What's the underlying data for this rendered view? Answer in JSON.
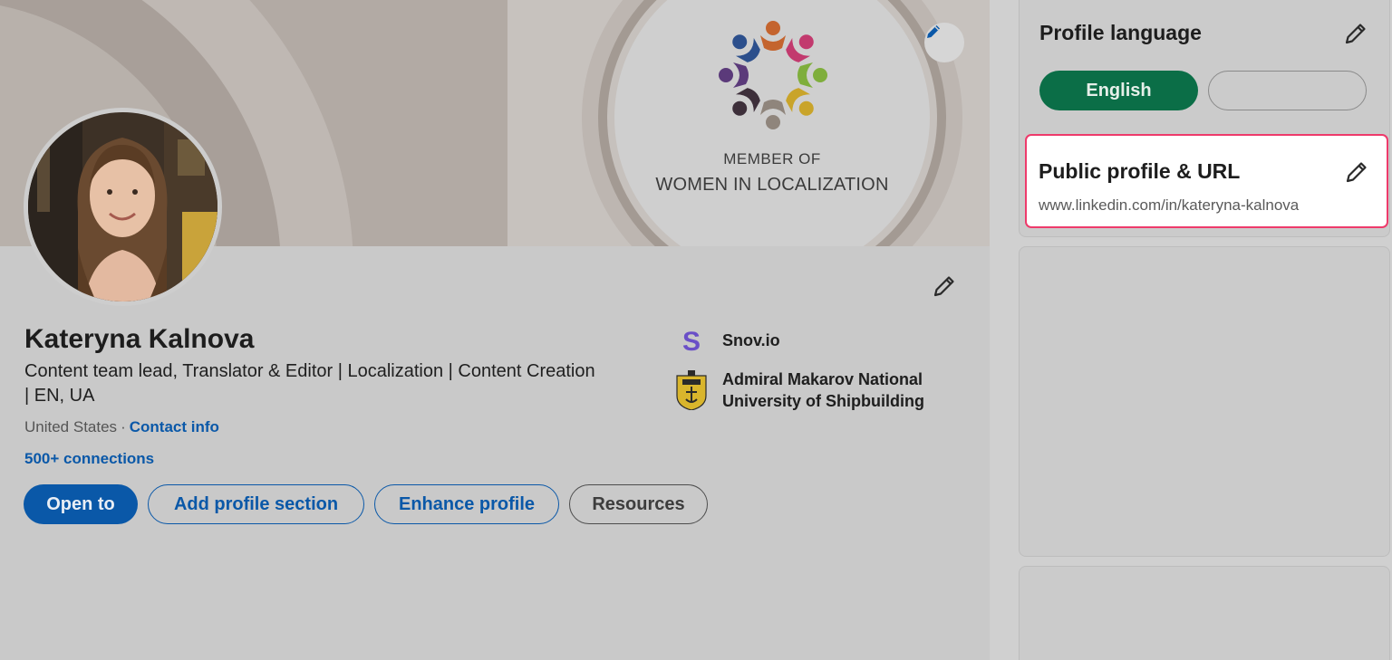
{
  "banner": {
    "line1": "MEMBER OF",
    "line2": "WOMEN IN LOCALIZATION"
  },
  "profile": {
    "name": "Kateryna Kalnova",
    "headline": "Content team lead, Translator & Editor | Localization | Content Creation | EN, UA",
    "location": "United States",
    "separator": "·",
    "contact_label": "Contact info",
    "connections": "500+ connections"
  },
  "actions": {
    "open_to": "Open to",
    "add_section": "Add profile section",
    "enhance": "Enhance profile",
    "resources": "Resources"
  },
  "organizations": [
    {
      "name": "Snov.io",
      "icon": "snovio-logo"
    },
    {
      "name_line1": "Admiral Makarov National",
      "name_line2": "University of Shipbuilding",
      "icon": "university-crest-logo"
    }
  ],
  "sidebar": {
    "language": {
      "title": "Profile language",
      "selected": "English"
    },
    "public_profile": {
      "title": "Public profile & URL",
      "url": "www.linkedin.com/in/kateryna-kalnova"
    }
  },
  "colors": {
    "brand_blue": "#0a58a8",
    "language_green": "#0b6e47",
    "highlight_border": "#ee3a6b"
  }
}
